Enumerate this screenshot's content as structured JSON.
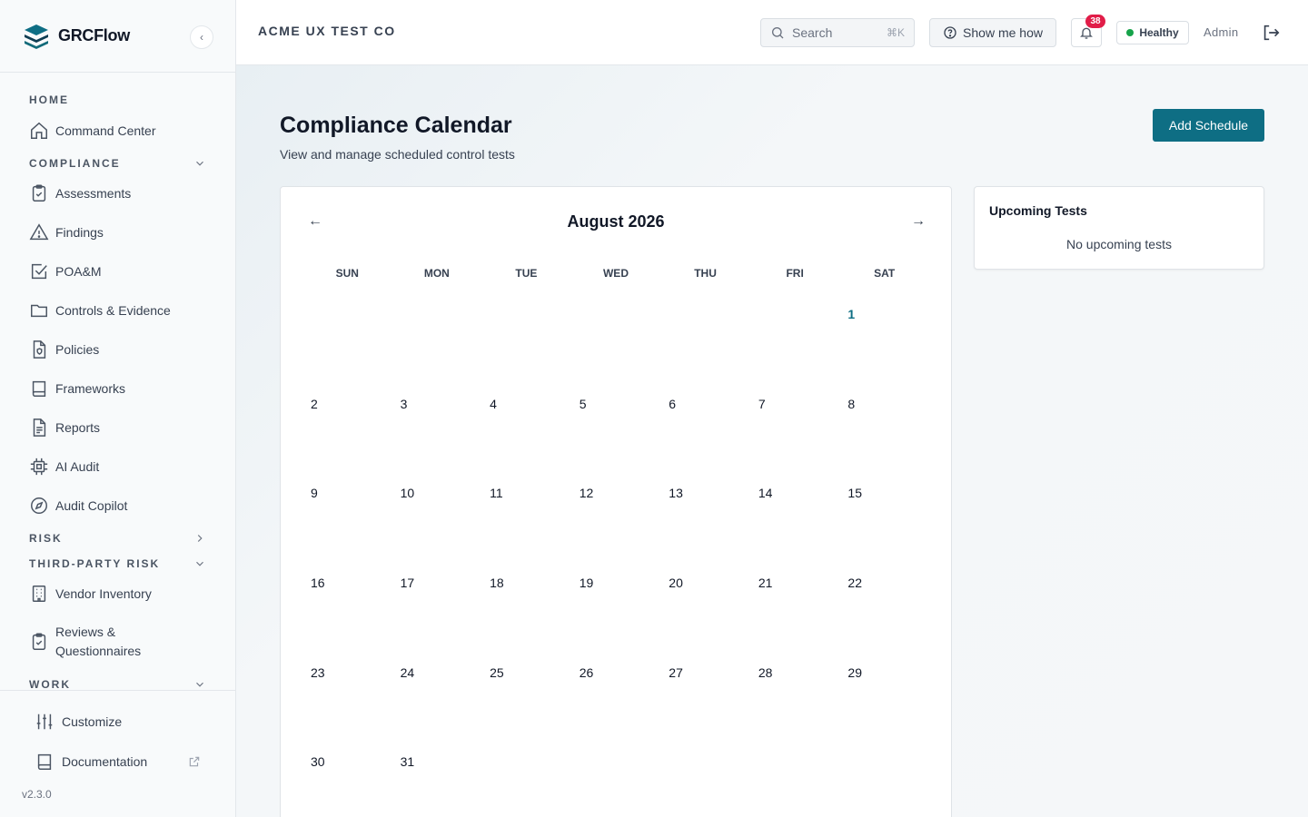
{
  "brand": {
    "name": "GRCFlow"
  },
  "sidebar": {
    "sections": {
      "home": "HOME",
      "compliance": "COMPLIANCE",
      "risk": "RISK",
      "third_party": "THIRD-PARTY RISK",
      "work": "WORK"
    },
    "items": {
      "command_center": "Command Center",
      "assessments": "Assessments",
      "findings": "Findings",
      "poam": "POA&M",
      "controls": "Controls & Evidence",
      "policies": "Policies",
      "frameworks": "Frameworks",
      "reports": "Reports",
      "ai_audit": "AI Audit",
      "audit_copilot": "Audit Copilot",
      "vendor_inventory": "Vendor Inventory",
      "reviews": "Reviews & Questionnaires"
    },
    "footer": {
      "customize": "Customize",
      "documentation": "Documentation",
      "version": "v2.3.0"
    }
  },
  "topbar": {
    "org": "ACME UX TEST CO",
    "search_label": "Search",
    "search_shortcut": "⌘K",
    "help": "Show me how",
    "notifications": "38",
    "status": "Healthy",
    "user": "Admin"
  },
  "page": {
    "title": "Compliance Calendar",
    "subtitle": "View and manage scheduled control tests",
    "add_button": "Add Schedule"
  },
  "calendar": {
    "prev": "←",
    "next": "→",
    "month": "August 2026",
    "weekdays": [
      "SUN",
      "MON",
      "TUE",
      "WED",
      "THU",
      "FRI",
      "SAT"
    ],
    "first_weekday": 6,
    "days_in_month": 31,
    "highlight_day": 1
  },
  "upcoming": {
    "title": "Upcoming Tests",
    "empty": "No upcoming tests"
  },
  "colors": {
    "accent": "#0e6e84",
    "badge": "#e11d48",
    "healthy": "#16a34a"
  }
}
